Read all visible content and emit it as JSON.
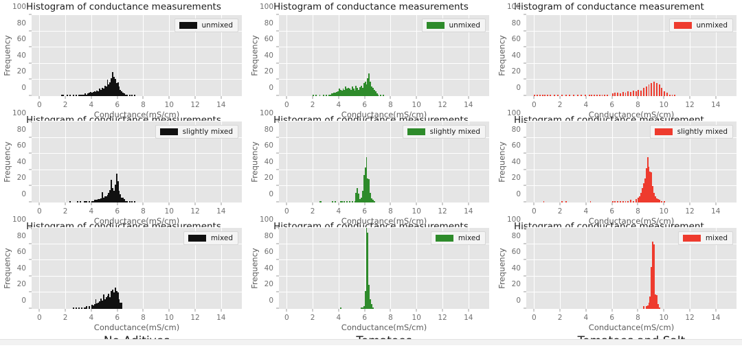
{
  "figure": {
    "axis": {
      "xlabel": "Conductance(mS/cm)",
      "ylabel": "Frequency",
      "xlim": [
        -0.6,
        15.6
      ],
      "ylim": [
        0,
        100
      ],
      "xticks": [
        0,
        2,
        4,
        6,
        8,
        10,
        12,
        14
      ],
      "yticks": [
        0,
        20,
        40,
        60,
        80,
        100
      ],
      "grid": true,
      "plot_bg": "#e5e5e5",
      "grid_color": "#ffffff"
    },
    "columns": [
      {
        "caption": "No Aditives",
        "color": "#111111"
      },
      {
        "caption": "Tomatoes",
        "color": "#2e8b2b"
      },
      {
        "caption": "Tomatoes and Salt",
        "color": "#ee3b2e"
      }
    ],
    "rows": [
      {
        "legend": "unmixed"
      },
      {
        "legend": "slightly mixed"
      },
      {
        "legend": "mixed"
      }
    ],
    "titles": [
      "Histogram of conductance measurements",
      "Histogram of conductance measurements",
      "Histogram of conductance measurement"
    ]
  },
  "chart_data": [
    {
      "type": "bar",
      "title": "Histogram of conductance measurements",
      "panel": "row1-col1",
      "series_name": "unmixed",
      "column": "No Aditives",
      "color": "#111111",
      "xlabel": "Conductance(mS/cm)",
      "ylabel": "Frequency",
      "xlim": [
        -0.6,
        15.6
      ],
      "ylim": [
        0,
        100
      ],
      "bin_width": 0.1,
      "bins": [
        1.7,
        1.8,
        2.1,
        2.3,
        2.6,
        2.8,
        3.0,
        3.1,
        3.2,
        3.3,
        3.4,
        3.5,
        3.6,
        3.7,
        3.8,
        3.9,
        4.0,
        4.1,
        4.2,
        4.3,
        4.4,
        4.5,
        4.6,
        4.7,
        4.8,
        4.9,
        5.0,
        5.1,
        5.2,
        5.3,
        5.4,
        5.5,
        5.6,
        5.7,
        5.8,
        5.9,
        6.0,
        6.1,
        6.2,
        6.3,
        6.4,
        6.5,
        6.6,
        6.7,
        6.9,
        7.1,
        7.3
      ],
      "values": [
        1,
        1,
        1,
        1,
        1,
        1,
        2,
        1,
        2,
        2,
        2,
        3,
        2,
        3,
        4,
        5,
        4,
        5,
        6,
        5,
        7,
        6,
        9,
        8,
        10,
        9,
        13,
        12,
        20,
        14,
        17,
        22,
        30,
        24,
        21,
        16,
        17,
        12,
        8,
        6,
        4,
        3,
        2,
        1,
        1,
        1,
        1
      ]
    },
    {
      "type": "bar",
      "title": "Histogram of conductance measurements",
      "panel": "row1-col2",
      "series_name": "unmixed",
      "column": "Tomatoes",
      "color": "#2e8b2b",
      "xlabel": "Conductance(mS/cm)",
      "ylabel": "Frequency",
      "xlim": [
        -0.6,
        15.6
      ],
      "ylim": [
        0,
        100
      ],
      "bin_width": 0.1,
      "bins": [
        2.0,
        2.2,
        2.5,
        2.8,
        3.0,
        3.2,
        3.3,
        3.4,
        3.5,
        3.6,
        3.7,
        3.8,
        3.9,
        4.0,
        4.1,
        4.2,
        4.3,
        4.4,
        4.5,
        4.6,
        4.7,
        4.8,
        4.9,
        5.0,
        5.1,
        5.2,
        5.3,
        5.4,
        5.5,
        5.6,
        5.7,
        5.8,
        5.9,
        6.0,
        6.1,
        6.2,
        6.3,
        6.4,
        6.5,
        6.6,
        6.7,
        6.8,
        6.9,
        7.0,
        7.2,
        7.4
      ],
      "values": [
        1,
        1,
        1,
        1,
        2,
        2,
        2,
        3,
        3,
        4,
        4,
        5,
        6,
        9,
        8,
        7,
        9,
        8,
        12,
        9,
        10,
        9,
        8,
        12,
        9,
        7,
        13,
        10,
        8,
        11,
        13,
        10,
        16,
        18,
        14,
        22,
        28,
        18,
        12,
        10,
        8,
        6,
        3,
        2,
        1,
        1
      ]
    },
    {
      "type": "bar",
      "title": "Histogram of conductance measurement",
      "panel": "row1-col3",
      "series_name": "unmixed",
      "column": "Tomatoes and Salt",
      "color": "#ee3b2e",
      "xlabel": "Conductance(mS/cm)",
      "ylabel": "Frequency",
      "xlim": [
        -0.6,
        15.6
      ],
      "ylim": [
        0,
        100
      ],
      "bin_width": 0.1,
      "bins": [
        0.0,
        0.2,
        0.4,
        0.6,
        0.8,
        1.0,
        1.2,
        1.5,
        1.8,
        2.1,
        2.4,
        2.7,
        3.0,
        3.3,
        3.6,
        3.9,
        4.2,
        4.4,
        4.6,
        4.8,
        5.0,
        5.2,
        5.4,
        5.6,
        6.0,
        6.2,
        6.4,
        6.6,
        6.8,
        7.0,
        7.2,
        7.4,
        7.6,
        7.8,
        8.0,
        8.2,
        8.4,
        8.6,
        8.8,
        9.0,
        9.2,
        9.4,
        9.6,
        9.8,
        10.0,
        10.2,
        10.4,
        10.6,
        10.8
      ],
      "values": [
        1,
        1,
        1,
        1,
        1,
        1,
        1,
        1,
        1,
        1,
        1,
        1,
        1,
        1,
        1,
        1,
        2,
        1,
        2,
        2,
        2,
        2,
        1,
        1,
        3,
        4,
        4,
        3,
        5,
        4,
        6,
        5,
        7,
        6,
        8,
        7,
        10,
        12,
        14,
        16,
        18,
        16,
        14,
        10,
        6,
        4,
        2,
        1,
        1
      ]
    },
    {
      "type": "bar",
      "title": "Histogram of conductance measurements",
      "panel": "row2-col1",
      "series_name": "slightly mixed",
      "column": "No Aditives",
      "color": "#111111",
      "xlabel": "Conductance(mS/cm)",
      "ylabel": "Frequency",
      "xlim": [
        -0.6,
        15.6
      ],
      "ylim": [
        0,
        100
      ],
      "bin_width": 0.1,
      "bins": [
        2.3,
        2.9,
        3.1,
        3.4,
        3.5,
        3.6,
        3.8,
        4.0,
        4.1,
        4.2,
        4.3,
        4.4,
        4.5,
        4.6,
        4.7,
        4.8,
        4.9,
        5.0,
        5.1,
        5.2,
        5.3,
        5.4,
        5.5,
        5.6,
        5.7,
        5.8,
        5.9,
        6.0,
        6.1,
        6.2,
        6.3,
        6.4,
        6.5,
        6.6,
        6.7,
        6.9,
        7.1,
        7.3
      ],
      "values": [
        1,
        1,
        1,
        1,
        1,
        2,
        1,
        2,
        2,
        3,
        3,
        3,
        4,
        4,
        5,
        13,
        6,
        8,
        8,
        9,
        12,
        15,
        28,
        18,
        14,
        22,
        36,
        26,
        14,
        10,
        6,
        6,
        4,
        2,
        1,
        1,
        1,
        1
      ]
    },
    {
      "type": "bar",
      "title": "Histogram of conductance measurements",
      "panel": "row2-col2",
      "series_name": "slightly mixed",
      "column": "Tomatoes",
      "color": "#2e8b2b",
      "xlabel": "Conductance(mS/cm)",
      "ylabel": "Frequency",
      "xlim": [
        -0.6,
        15.6
      ],
      "ylim": [
        0,
        100
      ],
      "bin_width": 0.1,
      "bins": [
        2.5,
        2.6,
        3.5,
        3.7,
        4.1,
        4.2,
        4.4,
        4.6,
        4.8,
        5.0,
        5.2,
        5.3,
        5.4,
        5.5,
        5.6,
        5.7,
        5.8,
        5.9,
        6.0,
        6.1,
        6.2,
        6.3,
        6.4,
        6.5,
        6.6,
        6.7
      ],
      "values": [
        1,
        1,
        1,
        1,
        2,
        1,
        1,
        1,
        1,
        1,
        2,
        12,
        18,
        11,
        4,
        6,
        14,
        34,
        43,
        56,
        30,
        29,
        12,
        5,
        3,
        1
      ]
    },
    {
      "type": "bar",
      "title": "Histogram of conductance measurement",
      "panel": "row2-col3",
      "series_name": "slightly mixed",
      "column": "Tomatoes and Salt",
      "color": "#ee3b2e",
      "xlabel": "Conductance(mS/cm)",
      "ylabel": "Frequency",
      "xlim": [
        -0.6,
        15.6
      ],
      "ylim": [
        0,
        100
      ],
      "bin_width": 0.1,
      "bins": [
        0.7,
        2.1,
        2.4,
        4.3,
        6.0,
        6.2,
        6.4,
        6.6,
        6.8,
        7.0,
        7.2,
        7.4,
        7.6,
        7.8,
        8.0,
        8.1,
        8.2,
        8.3,
        8.4,
        8.5,
        8.6,
        8.7,
        8.8,
        8.9,
        9.0,
        9.1,
        9.2,
        9.3,
        9.4,
        9.5,
        9.6,
        9.8,
        10.0
      ],
      "values": [
        1,
        1,
        1,
        1,
        1,
        1,
        1,
        1,
        2,
        1,
        2,
        3,
        2,
        4,
        6,
        8,
        12,
        18,
        24,
        30,
        42,
        56,
        44,
        38,
        37,
        20,
        12,
        8,
        5,
        4,
        3,
        2,
        1
      ]
    },
    {
      "type": "bar",
      "title": "Histogram of conductance measurements",
      "panel": "row3-col1",
      "series_name": "mixed",
      "column": "No Aditives",
      "color": "#111111",
      "xlabel": "Conductance(mS/cm)",
      "ylabel": "Frequency",
      "xlim": [
        -0.6,
        15.6
      ],
      "ylim": [
        0,
        100
      ],
      "bin_width": 0.1,
      "bins": [
        2.6,
        2.8,
        3.0,
        3.2,
        3.4,
        3.5,
        3.6,
        3.8,
        4.0,
        4.1,
        4.2,
        4.3,
        4.4,
        4.5,
        4.6,
        4.7,
        4.8,
        4.9,
        5.0,
        5.1,
        5.2,
        5.3,
        5.4,
        5.5,
        5.6,
        5.7,
        5.8,
        5.9,
        6.0,
        6.1,
        6.2,
        6.3
      ],
      "values": [
        1,
        1,
        1,
        2,
        2,
        2,
        3,
        3,
        5,
        4,
        6,
        12,
        7,
        8,
        9,
        13,
        10,
        18,
        12,
        14,
        16,
        19,
        14,
        22,
        24,
        20,
        26,
        22,
        20,
        12,
        8,
        8
      ]
    },
    {
      "type": "bar",
      "title": "Histogram of conductance measurements",
      "panel": "row3-col2",
      "series_name": "mixed",
      "column": "Tomatoes",
      "color": "#2e8b2b",
      "xlabel": "Conductance(mS/cm)",
      "ylabel": "Frequency",
      "xlim": [
        -0.6,
        15.6
      ],
      "ylim": [
        0,
        100
      ],
      "bin_width": 0.1,
      "bins": [
        4.1,
        5.7,
        5.8,
        5.9,
        6.0,
        6.1,
        6.2,
        6.3,
        6.4,
        6.5,
        6.6
      ],
      "values": [
        1,
        1,
        2,
        3,
        22,
        100,
        94,
        30,
        12,
        6,
        2
      ]
    },
    {
      "type": "bar",
      "title": "Histogram of conductance measurement",
      "panel": "row3-col3",
      "series_name": "mixed",
      "column": "Tomatoes and Salt",
      "color": "#ee3b2e",
      "xlabel": "Conductance(mS/cm)",
      "ylabel": "Frequency",
      "xlim": [
        -0.6,
        15.6
      ],
      "ylim": [
        0,
        100
      ],
      "bin_width": 0.1,
      "bins": [
        8.4,
        8.6,
        8.7,
        8.8,
        8.9,
        9.0,
        9.1,
        9.2,
        9.3,
        9.4,
        9.5,
        9.6
      ],
      "values": [
        3,
        3,
        4,
        8,
        15,
        52,
        83,
        80,
        18,
        17,
        6,
        2
      ]
    }
  ]
}
